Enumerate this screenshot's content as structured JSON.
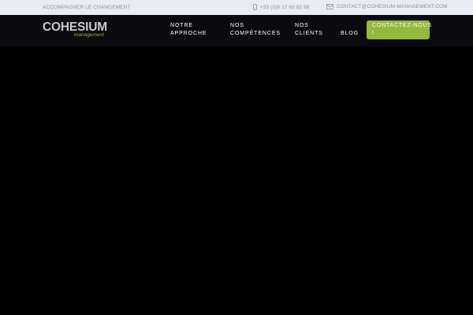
{
  "topbar": {
    "tagline": "ACCOMPAGNER LE CHANGEMENT",
    "phone": "+33 (0)6 17 68 82 98",
    "phone_icon": "mobile-phone-icon",
    "email": "CONTACT@COHESIUM-MANAGEMENT.COM",
    "email_icon": "envelope-icon"
  },
  "header": {
    "logo_word": "COHESIUM",
    "logo_sub": "management",
    "nav": [
      {
        "line1": "NOTRE",
        "line2": "APPROCHE"
      },
      {
        "line1": "NOS",
        "line2": "COMPÉTENCES"
      },
      {
        "line1": "NOS",
        "line2": "CLIENTS"
      },
      {
        "line1": "BLOG",
        "line2": ""
      }
    ],
    "cta": {
      "line1": "CONTACTEZ-NOUS",
      "line2": "!"
    }
  },
  "colors": {
    "topbar_bg": "#e9ecf2",
    "nav_bg": "#0b0b0f",
    "accent": "#96b93c",
    "page_bg": "#000000"
  }
}
